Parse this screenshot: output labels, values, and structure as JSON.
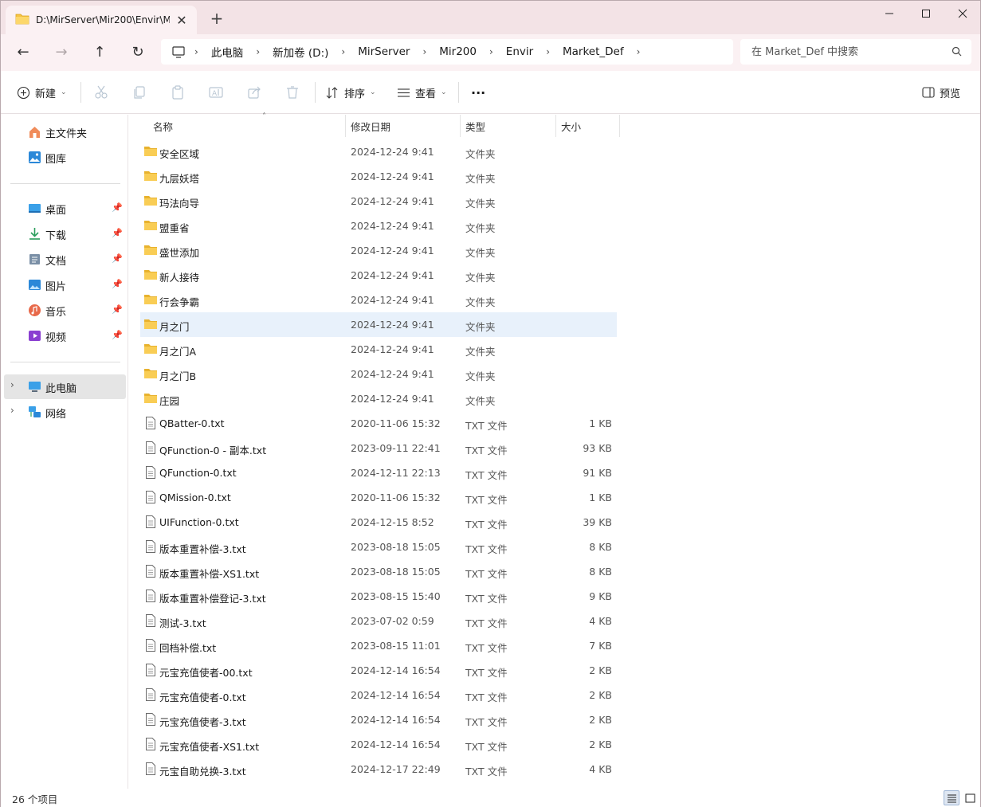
{
  "window": {
    "tab_title": "D:\\MirServer\\Mir200\\Envir\\Market_Def",
    "minimize_label": "minimize",
    "maximize_label": "maximize",
    "close_label": "close"
  },
  "breadcrumb": [
    "此电脑",
    "新加卷 (D:)",
    "MirServer",
    "Mir200",
    "Envir",
    "Market_Def"
  ],
  "search": {
    "placeholder": "在 Market_Def 中搜索"
  },
  "toolbar": {
    "new_label": "新建",
    "sort_label": "排序",
    "view_label": "查看",
    "more_label": "...",
    "preview_label": "预览"
  },
  "sidebar": {
    "items": [
      {
        "label": "主文件夹",
        "icon": "home-icon"
      },
      {
        "label": "图库",
        "icon": "gallery-icon"
      },
      {
        "label": "桌面",
        "icon": "desktop-icon"
      },
      {
        "label": "下载",
        "icon": "download-icon"
      },
      {
        "label": "文档",
        "icon": "documents-icon"
      },
      {
        "label": "图片",
        "icon": "pictures-icon"
      },
      {
        "label": "音乐",
        "icon": "music-icon"
      },
      {
        "label": "视频",
        "icon": "videos-icon"
      },
      {
        "label": "此电脑",
        "icon": "this-pc-icon"
      },
      {
        "label": "网络",
        "icon": "network-icon"
      }
    ]
  },
  "columns": {
    "name": "名称",
    "date": "修改日期",
    "type": "类型",
    "size": "大小"
  },
  "files": [
    {
      "name": "安全区域",
      "date": "2024-12-24 9:41",
      "type": "文件夹",
      "size": "",
      "kind": "folder"
    },
    {
      "name": "九层妖塔",
      "date": "2024-12-24 9:41",
      "type": "文件夹",
      "size": "",
      "kind": "folder"
    },
    {
      "name": "玛法向导",
      "date": "2024-12-24 9:41",
      "type": "文件夹",
      "size": "",
      "kind": "folder"
    },
    {
      "name": "盟重省",
      "date": "2024-12-24 9:41",
      "type": "文件夹",
      "size": "",
      "kind": "folder"
    },
    {
      "name": "盛世添加",
      "date": "2024-12-24 9:41",
      "type": "文件夹",
      "size": "",
      "kind": "folder"
    },
    {
      "name": "新人接待",
      "date": "2024-12-24 9:41",
      "type": "文件夹",
      "size": "",
      "kind": "folder"
    },
    {
      "name": "行会争霸",
      "date": "2024-12-24 9:41",
      "type": "文件夹",
      "size": "",
      "kind": "folder"
    },
    {
      "name": "月之门",
      "date": "2024-12-24 9:41",
      "type": "文件夹",
      "size": "",
      "kind": "folder"
    },
    {
      "name": "月之门A",
      "date": "2024-12-24 9:41",
      "type": "文件夹",
      "size": "",
      "kind": "folder"
    },
    {
      "name": "月之门B",
      "date": "2024-12-24 9:41",
      "type": "文件夹",
      "size": "",
      "kind": "folder"
    },
    {
      "name": "庄园",
      "date": "2024-12-24 9:41",
      "type": "文件夹",
      "size": "",
      "kind": "folder"
    },
    {
      "name": "QBatter-0.txt",
      "date": "2020-11-06 15:32",
      "type": "TXT 文件",
      "size": "1 KB",
      "kind": "txt"
    },
    {
      "name": "QFunction-0 - 副本.txt",
      "date": "2023-09-11 22:41",
      "type": "TXT 文件",
      "size": "93 KB",
      "kind": "txt"
    },
    {
      "name": "QFunction-0.txt",
      "date": "2024-12-11 22:13",
      "type": "TXT 文件",
      "size": "91 KB",
      "kind": "txt"
    },
    {
      "name": "QMission-0.txt",
      "date": "2020-11-06 15:32",
      "type": "TXT 文件",
      "size": "1 KB",
      "kind": "txt"
    },
    {
      "name": "UIFunction-0.txt",
      "date": "2024-12-15 8:52",
      "type": "TXT 文件",
      "size": "39 KB",
      "kind": "txt"
    },
    {
      "name": "版本重置补偿-3.txt",
      "date": "2023-08-18 15:05",
      "type": "TXT 文件",
      "size": "8 KB",
      "kind": "txt"
    },
    {
      "name": "版本重置补偿-XS1.txt",
      "date": "2023-08-18 15:05",
      "type": "TXT 文件",
      "size": "8 KB",
      "kind": "txt"
    },
    {
      "name": "版本重置补偿登记-3.txt",
      "date": "2023-08-15 15:40",
      "type": "TXT 文件",
      "size": "9 KB",
      "kind": "txt"
    },
    {
      "name": "测试-3.txt",
      "date": "2023-07-02 0:59",
      "type": "TXT 文件",
      "size": "4 KB",
      "kind": "txt"
    },
    {
      "name": "回档补偿.txt",
      "date": "2023-08-15 11:01",
      "type": "TXT 文件",
      "size": "7 KB",
      "kind": "txt"
    },
    {
      "name": "元宝充值使者-00.txt",
      "date": "2024-12-14 16:54",
      "type": "TXT 文件",
      "size": "2 KB",
      "kind": "txt"
    },
    {
      "name": "元宝充值使者-0.txt",
      "date": "2024-12-14 16:54",
      "type": "TXT 文件",
      "size": "2 KB",
      "kind": "txt"
    },
    {
      "name": "元宝充值使者-3.txt",
      "date": "2024-12-14 16:54",
      "type": "TXT 文件",
      "size": "2 KB",
      "kind": "txt"
    },
    {
      "name": "元宝充值使者-XS1.txt",
      "date": "2024-12-14 16:54",
      "type": "TXT 文件",
      "size": "2 KB",
      "kind": "txt"
    },
    {
      "name": "元宝自助兑换-3.txt",
      "date": "2024-12-17 22:49",
      "type": "TXT 文件",
      "size": "4 KB",
      "kind": "txt"
    }
  ],
  "status": {
    "count": "26 个项目"
  },
  "colors": {
    "accent": "#0067c0",
    "folder": "#f6c343",
    "selection": "#e8f1fb"
  }
}
